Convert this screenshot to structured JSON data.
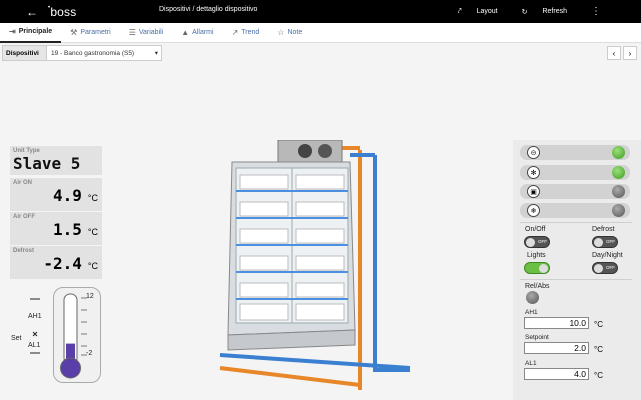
{
  "topbar": {
    "back_icon": "arrow-left-icon",
    "logo": "boss",
    "breadcrumb": "Dispositivi / dettaglio dispositivo",
    "layout_label": "Layout",
    "refresh_label": "Refresh",
    "menu_icon": "kebab-menu-icon"
  },
  "tabs": [
    {
      "label": "Principale",
      "icon": "home-icon",
      "active": true
    },
    {
      "label": "Parametri",
      "icon": "wrench-icon"
    },
    {
      "label": "Variabili",
      "icon": "list-icon"
    },
    {
      "label": "Allarmi",
      "icon": "bell-icon"
    },
    {
      "label": "Trend",
      "icon": "chart-icon"
    },
    {
      "label": "Note",
      "icon": "pin-icon"
    }
  ],
  "devices": {
    "label": "Dispositivi",
    "selected": "19 - Banco gastronomia (S5)"
  },
  "readouts": {
    "unit_type_label": "Unit Type",
    "unit_type_value": "Slave 5",
    "air_on_label": "Air ON",
    "air_on_value": "4.9",
    "air_off_label": "Air OFF",
    "air_off_value": "1.5",
    "defrost_label": "Defrost",
    "defrost_value": "-2.4",
    "unit": "°C"
  },
  "thermometer": {
    "max": "12",
    "min": "-2",
    "ah1": "AH1",
    "al1": "AL1",
    "set": "Set",
    "level": 0.32
  },
  "status_strips": [
    {
      "icon": "compressor-icon",
      "led": "green"
    },
    {
      "icon": "fan-icon",
      "led": "green"
    },
    {
      "icon": "door-icon",
      "led": "gray"
    },
    {
      "icon": "defrost-icon",
      "led": "gray"
    }
  ],
  "switches": {
    "onoff_label": "On/Off",
    "onoff_state": "OFF",
    "defrost_label": "Defrost",
    "defrost_state": "OFF",
    "lights_label": "Lights",
    "lights_state": "ON",
    "daynight_label": "Day/Night",
    "daynight_state": "OFF",
    "relabs_label": "Rel/Abs"
  },
  "setpoints": {
    "ah1_label": "AH1",
    "ah1_value": "10.0",
    "setpoint_label": "Setpoint",
    "setpoint_value": "2.0",
    "al1_label": "AL1",
    "al1_value": "4.0",
    "unit": "°C"
  }
}
